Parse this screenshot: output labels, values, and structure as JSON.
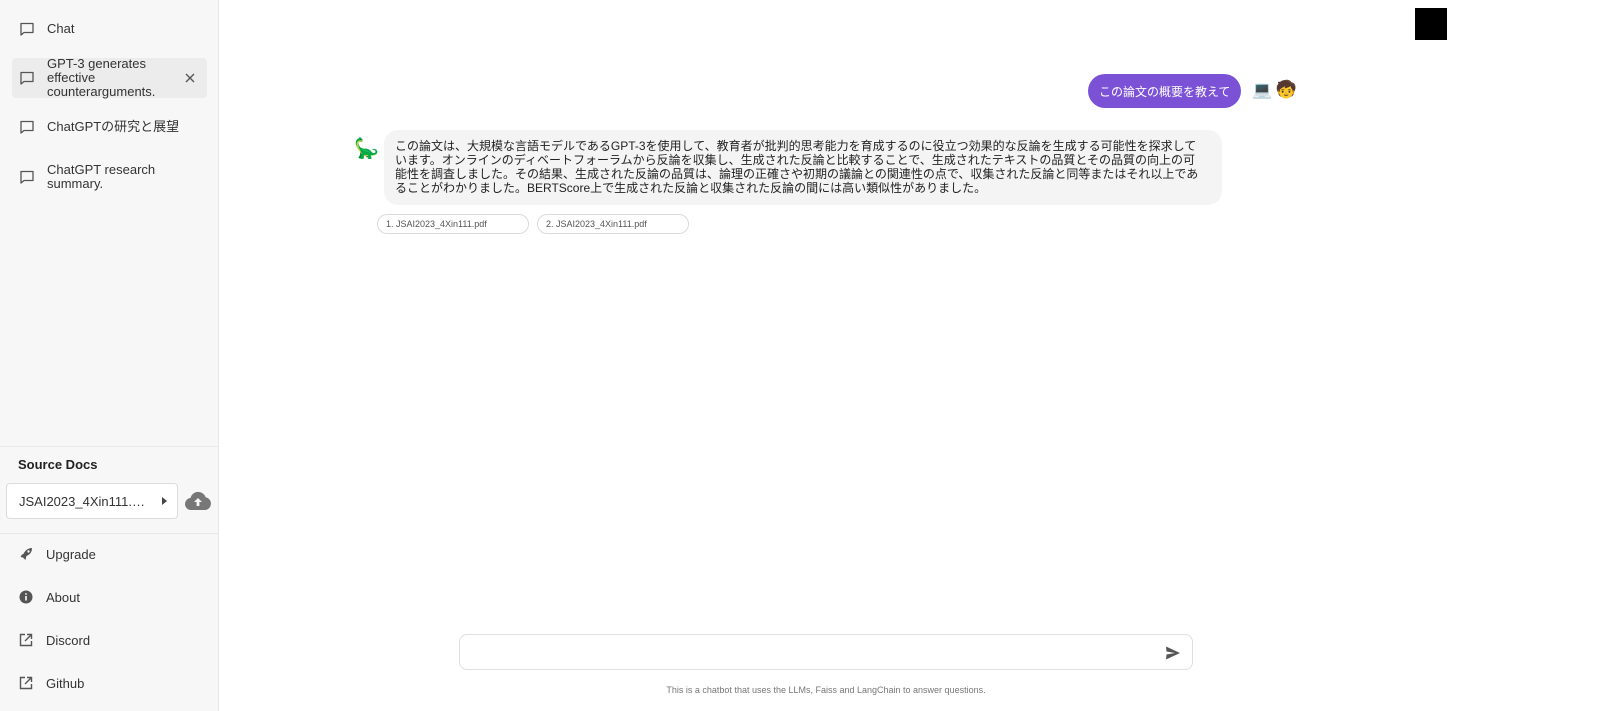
{
  "sidebar": {
    "conversations": [
      {
        "label": "Chat"
      },
      {
        "label": "GPT-3 generates effective counterarguments."
      },
      {
        "label": "ChatGPTの研究と展望"
      },
      {
        "label": "ChatGPT research summary."
      }
    ],
    "source_docs": {
      "title": "Source Docs",
      "selected": "JSAI2023_4Xin111.pdf"
    },
    "links": [
      {
        "label": "Upgrade",
        "icon": "rocket-icon"
      },
      {
        "label": "About",
        "icon": "info-icon"
      },
      {
        "label": "Discord",
        "icon": "external-link-icon"
      },
      {
        "label": "Github",
        "icon": "external-link-icon"
      }
    ]
  },
  "chat": {
    "user_message": "この論文の概要を教えて",
    "user_icons": [
      "💻",
      "🧒"
    ],
    "bot_avatar": "🦕",
    "bot_message": "この論文は、大規模な言語モデルであるGPT-3を使用して、教育者が批判的思考能力を育成するのに役立つ効果的な反論を生成する可能性を探求しています。オンラインのディベートフォーラムから反論を収集し、生成された反論と比較することで、生成されたテキストの品質とその品質の向上の可能性を調査しました。その結果、生成された反論の品質は、論理の正確さや初期の議論との関連性の点で、収集された反論と同等またはそれ以上であることがわかりました。BERTScore上で生成された反論と収集された反論の間には高い類似性がありました。",
    "sources": [
      {
        "label": "1. JSAI2023_4Xin111.pdf"
      },
      {
        "label": "2. JSAI2023_4Xin111.pdf"
      }
    ]
  },
  "input": {
    "value": "",
    "placeholder": ""
  },
  "disclaimer": "This is a chatbot that uses the LLMs, Faiss and LangChain to answer questions.",
  "colors": {
    "accent": "#7b52d6",
    "sidebar_bg": "#f7f7f7"
  }
}
